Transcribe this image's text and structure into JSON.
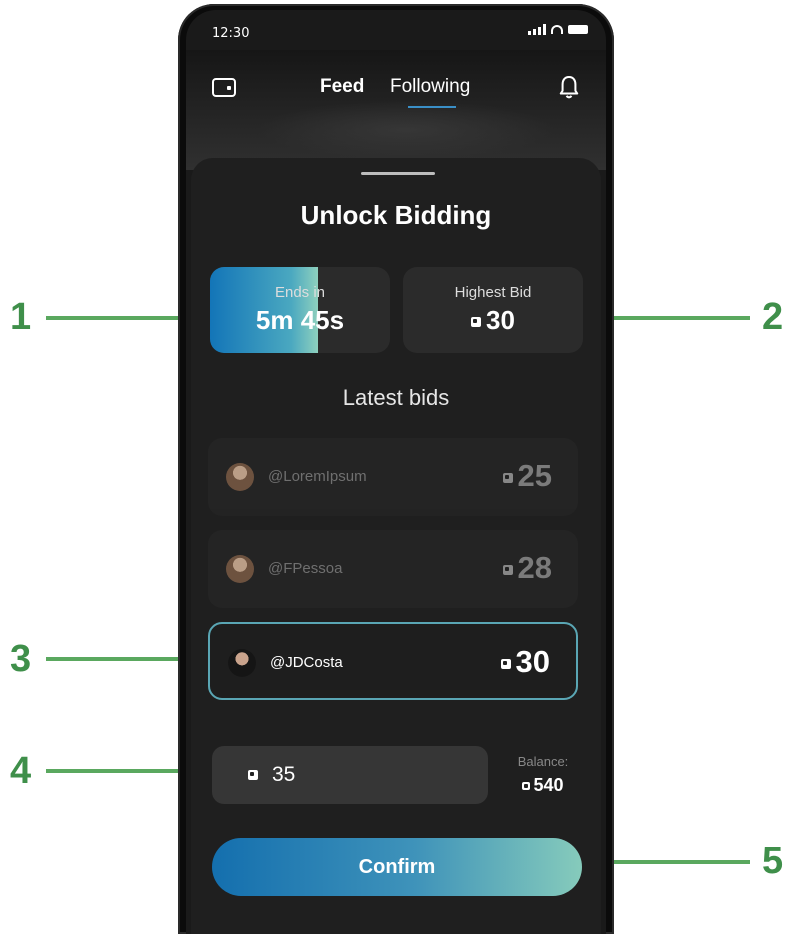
{
  "status_bar": {
    "time": "12:30"
  },
  "nav": {
    "tabs": [
      {
        "label": "Feed"
      },
      {
        "label": "Following"
      }
    ],
    "active_tab": "Following"
  },
  "sheet": {
    "title": "Unlock Bidding",
    "ends_in": {
      "label": "Ends in",
      "value": "5m 45s",
      "progress": 0.6
    },
    "highest_bid": {
      "label": "Highest Bid",
      "value": "30"
    },
    "latest_bids_title": "Latest bids",
    "bids": [
      {
        "user": "@LoremIpsum",
        "amount": "25"
      },
      {
        "user": "@FPessoa",
        "amount": "28"
      },
      {
        "user": "@JDCosta",
        "amount": "30"
      }
    ],
    "bid_input": {
      "value": "35"
    },
    "balance": {
      "label": "Balance:",
      "value": "540"
    },
    "confirm_label": "Confirm"
  },
  "callouts": [
    "1",
    "2",
    "3",
    "4",
    "5"
  ],
  "colors": {
    "accent": "#1375b8",
    "accent_light": "#86cbbb",
    "callout": "#3f8f4a"
  }
}
